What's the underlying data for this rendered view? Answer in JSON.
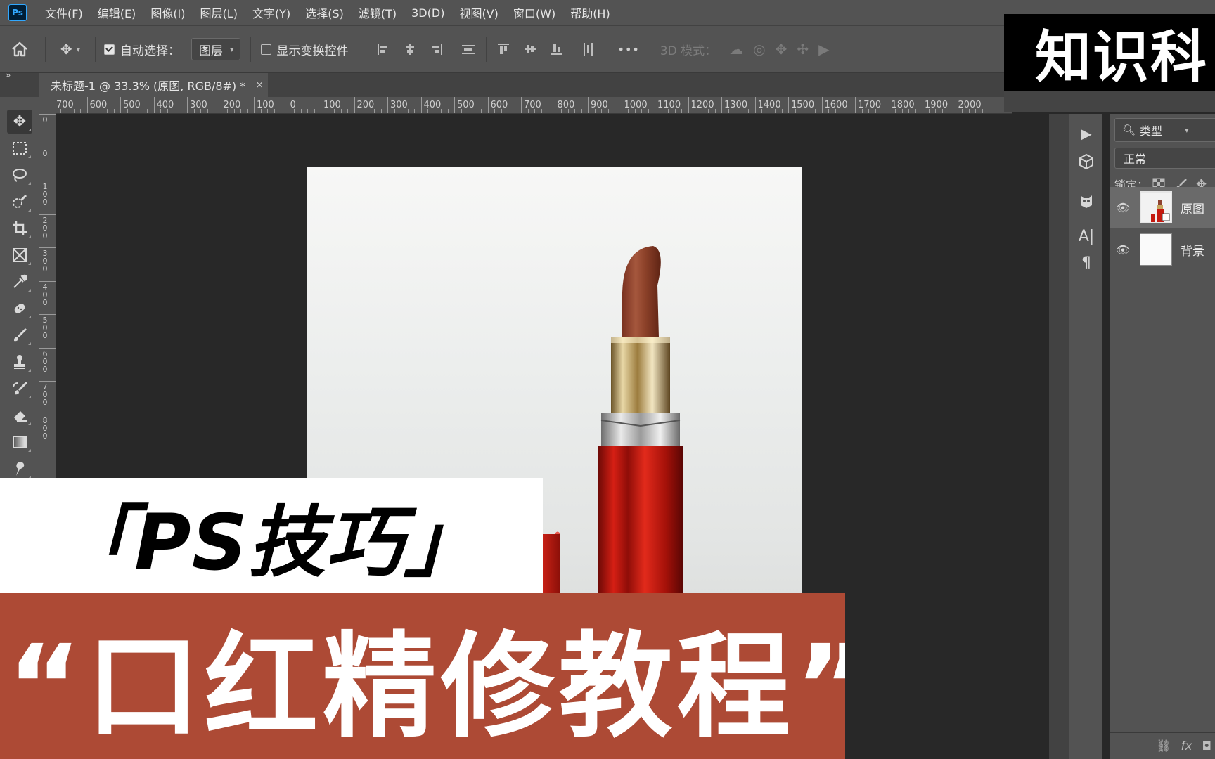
{
  "app": {
    "logo": "Ps",
    "accent": "#31a8ff"
  },
  "menu": [
    "文件(F)",
    "编辑(E)",
    "图像(I)",
    "图层(L)",
    "文字(Y)",
    "选择(S)",
    "滤镜(T)",
    "3D(D)",
    "视图(V)",
    "窗口(W)",
    "帮助(H)"
  ],
  "options": {
    "auto_select_label": "自动选择：",
    "auto_select_checked": true,
    "auto_select_target": "图层",
    "show_transform_label": "显示变换控件",
    "show_transform_checked": false,
    "mode_3d_label": "3D 模式：",
    "more": "•••"
  },
  "document": {
    "tab_title": "未标题-1 @ 33.3% (原图, RGB/8#) *",
    "close": "×"
  },
  "ruler": {
    "horizontal": [
      "700",
      "600",
      "500",
      "400",
      "300",
      "200",
      "100",
      "0",
      "100",
      "200",
      "300",
      "400",
      "500",
      "600",
      "700",
      "800",
      "900",
      "1000",
      "1100",
      "1200",
      "1300",
      "1400",
      "1500",
      "1600",
      "1700",
      "1800",
      "1900",
      "2000"
    ],
    "vertical": [
      "0",
      "0",
      "1\n0\n0",
      "2\n0\n0",
      "3\n0\n0",
      "4\n0\n0",
      "5\n0\n0",
      "6\n0\n0",
      "7\n0\n0",
      "8\n0\n0"
    ]
  },
  "tools": [
    "move-icon",
    "marquee-icon",
    "lasso-icon",
    "quick-select-icon",
    "crop-icon",
    "frame-icon",
    "eyedropper-icon",
    "healing-brush-icon",
    "brush-icon",
    "clone-stamp-icon",
    "history-brush-icon",
    "eraser-icon",
    "gradient-icon",
    "smudge-icon"
  ],
  "layers_panel": {
    "filter_label": "类型",
    "blend_mode": "正常",
    "lock_label": "锁定：",
    "layers": [
      {
        "name": "原图",
        "visible": true,
        "selected": true
      },
      {
        "name": "背景",
        "visible": true,
        "selected": false
      }
    ],
    "footer_fx": "fx"
  },
  "overlay": {
    "brand": "知识科",
    "tip": "「PS技巧」",
    "title": "“口红精修教程”",
    "title_bg": "#ad4a35"
  }
}
